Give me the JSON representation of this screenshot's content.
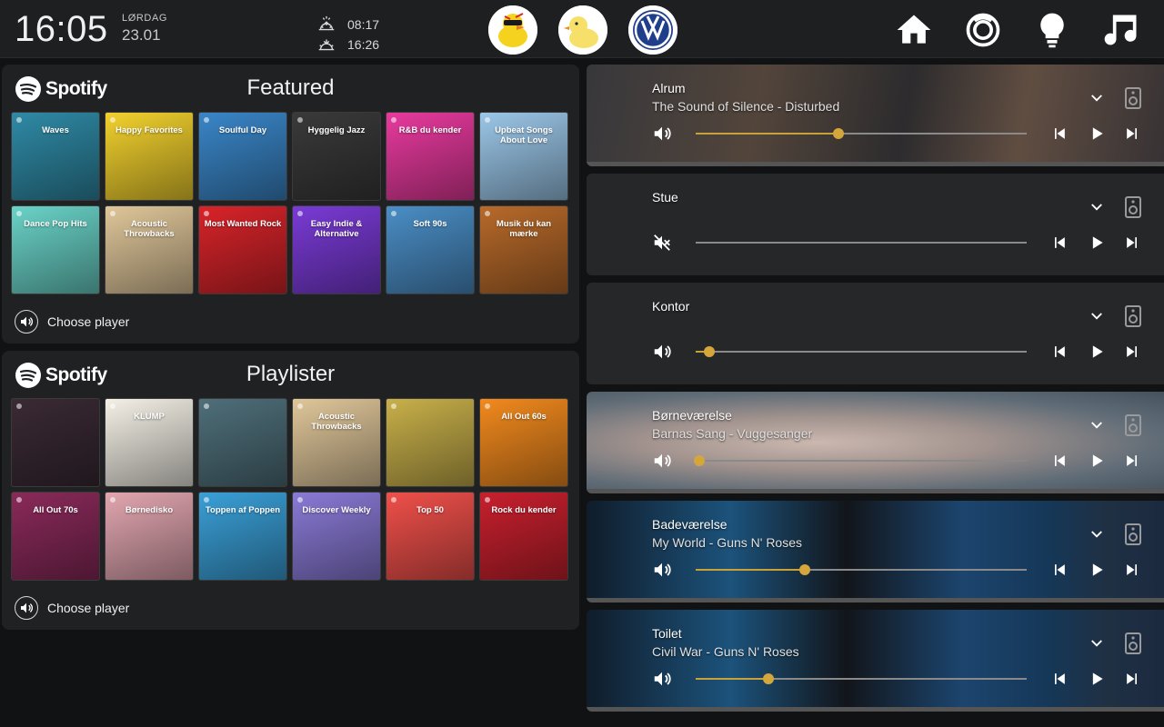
{
  "header": {
    "time": "16:05",
    "weekday": "LØRDAG",
    "date": "23.01",
    "sunrise": "08:17",
    "sunset": "16:26",
    "avatars": [
      "rubber-duck-sunglasses-avatar",
      "rubber-duck-avatar",
      "volkswagen-logo-avatar"
    ],
    "nav_icons": [
      "home-icon",
      "robot-vacuum-icon",
      "lightbulb-icon",
      "music-note-icon"
    ]
  },
  "featured": {
    "brand": "Spotify",
    "title": "Featured",
    "choose_player": "Choose player",
    "tiles": [
      {
        "label": "Waves",
        "color": "#2f8aa6"
      },
      {
        "label": "Happy Favorites",
        "color": "#f2d12e"
      },
      {
        "label": "Soulful Day",
        "color": "#3a86c8"
      },
      {
        "label": "Hyggelig Jazz",
        "color": "#3a3a3a"
      },
      {
        "label": "R&B du kender",
        "color": "#e83a9e"
      },
      {
        "label": "Upbeat Songs About Love",
        "color": "#9bc7e8"
      },
      {
        "label": "Dance Pop Hits",
        "color": "#6ad3c8"
      },
      {
        "label": "Acoustic Throwbacks",
        "color": "#e0c79a"
      },
      {
        "label": "Most Wanted Rock",
        "color": "#d8242a"
      },
      {
        "label": "Easy Indie & Alternative",
        "color": "#7a3bd6"
      },
      {
        "label": "Soft 90s",
        "color": "#4a8ec6"
      },
      {
        "label": "Musik du kan mærke",
        "color": "#b86a2a"
      }
    ]
  },
  "playlists": {
    "brand": "Spotify",
    "title": "Playlister",
    "choose_player": "Choose player",
    "tiles": [
      {
        "label": "",
        "color": "#3a2a34"
      },
      {
        "label": "KLUMP",
        "color": "#f4f0e6"
      },
      {
        "label": "",
        "color": "#4f6f7a"
      },
      {
        "label": "Acoustic Throwbacks",
        "color": "#e0c79a"
      },
      {
        "label": "",
        "color": "#c8b04a"
      },
      {
        "label": "All Out 60s",
        "color": "#f28a1e"
      },
      {
        "label": "All Out 70s",
        "color": "#8a2a5a"
      },
      {
        "label": "Børnedisko",
        "color": "#e2a6b0"
      },
      {
        "label": "Toppen af Poppen",
        "color": "#3aa0d8"
      },
      {
        "label": "Discover Weekly",
        "color": "#8a7ad6"
      },
      {
        "label": "Top 50",
        "color": "#f0504a"
      },
      {
        "label": "Rock du kender",
        "color": "#c8202e"
      }
    ]
  },
  "players": [
    {
      "name": "Alrum",
      "track": "The Sound of Silence - Disturbed",
      "volume": 0.43,
      "muted": false,
      "bg": "alrum"
    },
    {
      "name": "Stue",
      "track": "",
      "volume": 0.0,
      "muted": true,
      "bg": "none"
    },
    {
      "name": "Kontor",
      "track": "",
      "volume": 0.04,
      "muted": false,
      "bg": "none"
    },
    {
      "name": "Børneværelse",
      "track": "Barnas Sang - Vuggesanger",
      "volume": 0.01,
      "muted": false,
      "bg": "baby"
    },
    {
      "name": "Badeværelse",
      "track": "My World - Guns N' Roses",
      "volume": 0.33,
      "muted": false,
      "bg": "gnr"
    },
    {
      "name": "Toilet",
      "track": "Civil War - Guns N' Roses",
      "volume": 0.22,
      "muted": false,
      "bg": "gnr"
    }
  ],
  "colors": {
    "accent": "#d4a63b",
    "card": "#202123",
    "background": "#111214"
  }
}
